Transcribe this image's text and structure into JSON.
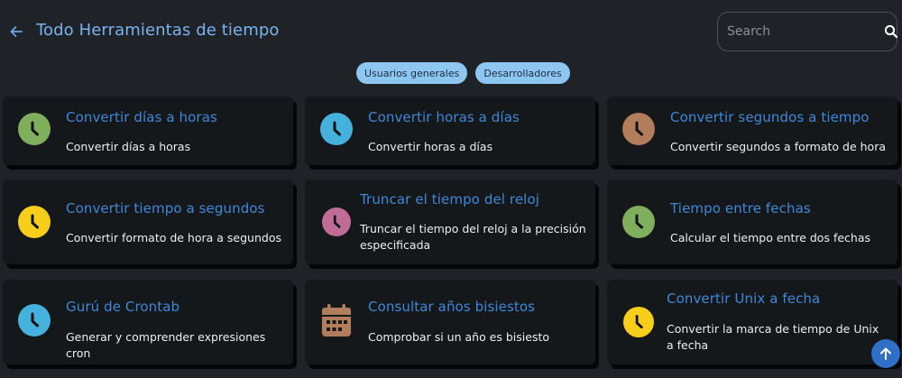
{
  "header": {
    "title": "Todo Herramientas de tiempo",
    "search_placeholder": "Search"
  },
  "filters": [
    {
      "label": "Usuarios generales"
    },
    {
      "label": "Desarrolladores"
    }
  ],
  "cards": [
    {
      "title": "Convertir días a horas",
      "description": "Convertir días a horas",
      "icon": "clock-icon",
      "color": "#7fae5c"
    },
    {
      "title": "Convertir horas a días",
      "description": "Convertir horas a días",
      "icon": "clock-icon",
      "color": "#45b2de"
    },
    {
      "title": "Convertir segundos a tiempo",
      "description": "Convertir segundos a formato de hora",
      "icon": "clock-icon",
      "color": "#b27d5a"
    },
    {
      "title": "Convertir tiempo a segundos",
      "description": "Convertir formato de hora a segundos",
      "icon": "clock-icon",
      "color": "#f7cf1b"
    },
    {
      "title": "Truncar el tiempo del reloj",
      "description": "Truncar el tiempo del reloj a la precisión especificada",
      "icon": "clock-icon",
      "color": "#bf6c97"
    },
    {
      "title": "Tiempo entre fechas",
      "description": "Calcular el tiempo entre dos fechas",
      "icon": "clock-icon",
      "color": "#7fae5c"
    },
    {
      "title": "Gurú de Crontab",
      "description": "Generar y comprender expresiones cron",
      "icon": "clock-icon",
      "color": "#45b2de"
    },
    {
      "title": "Consultar años bisiestos",
      "description": "Comprobar si un año es bisiesto",
      "icon": "calendar-icon",
      "color": "#b27d5a"
    },
    {
      "title": "Convertir Unix a fecha",
      "description": "Convertir la marca de tiempo de Unix a fecha",
      "icon": "clock-icon",
      "color": "#f7cf1b"
    }
  ]
}
